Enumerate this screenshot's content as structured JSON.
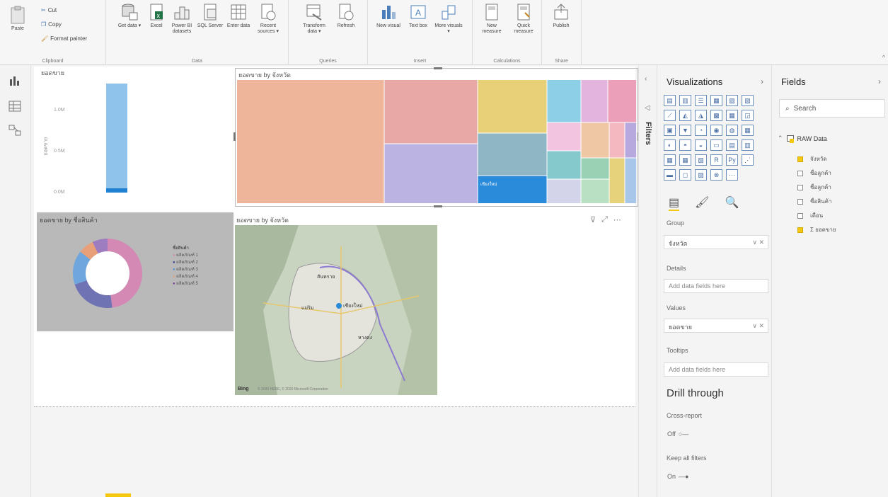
{
  "ribbon": {
    "clipboard": {
      "paste": "Paste",
      "cut": "Cut",
      "copy": "Copy",
      "format_painter": "Format painter",
      "label": "Clipboard"
    },
    "data": {
      "get_data": "Get data ▾",
      "excel": "Excel",
      "powerbi": "Power BI datasets",
      "sql": "SQL Server",
      "enter": "Enter data",
      "recent": "Recent sources ▾",
      "label": "Data"
    },
    "queries": {
      "transform": "Transform data ▾",
      "refresh": "Refresh",
      "label": "Queries"
    },
    "insert": {
      "new_visual": "New visual",
      "text_box": "Text box",
      "more_visuals": "More visuals ▾",
      "label": "Insert"
    },
    "calculations": {
      "new_measure": "New measure",
      "quick_measure": "Quick measure",
      "label": "Calculations"
    },
    "share": {
      "publish": "Publish",
      "label": "Share"
    }
  },
  "visuals": {
    "bar": {
      "title": "ยอดขาย",
      "yaxis": "ยอดขาย",
      "ticks": [
        "1.0M",
        "0.5M",
        "0.0M"
      ]
    },
    "treemap": {
      "title": "ยอดขาย by จังหวัด",
      "selected_label": "เชียงใหม่"
    },
    "donut": {
      "title": "ยอดขาย by ชื่อสินค้า",
      "legend_title": "ชื่อสินค้า",
      "legend": [
        "ผลิตภัณฑ์ 1",
        "ผลิตภัณฑ์ 2",
        "ผลิตภัณฑ์ 3",
        "ผลิตภัณฑ์ 4",
        "ผลิตภัณฑ์ 5"
      ]
    },
    "map": {
      "title": "ยอดขาย by จังหวัด",
      "labels": [
        "เชียงใหม่",
        "สันทราย",
        "หางดง",
        "แม่ริม"
      ],
      "attribution": "Bing",
      "copyright": "© 2020 HERE, © 2020 Microsoft Corporation"
    }
  },
  "filters": {
    "label": "Filters"
  },
  "viz_pane": {
    "title": "Visualizations",
    "icons": [
      "▤",
      "▥",
      "☰",
      "▦",
      "▧",
      "▨",
      "⟋",
      "◭",
      "◮",
      "▩",
      "▦",
      "◲",
      "▣",
      "▼",
      "◔",
      "◉",
      "◍",
      "▦",
      "◐",
      "◓",
      "◒",
      "▭",
      "▤",
      "▥",
      "▦",
      "▦",
      "▧",
      "R",
      "Py",
      "⋰",
      "▬",
      "◻",
      "▨",
      "⊗",
      "⋯"
    ],
    "tabs": [
      "fields-icon",
      "format-icon",
      "analytics-icon"
    ],
    "group_label": "Group",
    "group_value": "จังหวัด",
    "details_label": "Details",
    "details_placeholder": "Add data fields here",
    "values_label": "Values",
    "values_value": "ยอดขาย",
    "tooltips_label": "Tooltips",
    "tooltips_placeholder": "Add data fields here",
    "drill_title": "Drill through",
    "cross_report": "Cross-report",
    "cross_state": "Off",
    "keep_filters": "Keep all filters",
    "keep_state": "On"
  },
  "fields_pane": {
    "title": "Fields",
    "search_placeholder": "Search",
    "table": "RAW Data",
    "fields": [
      {
        "name": "จังหวัด",
        "checked": true
      },
      {
        "name": "ชื่อลูกค้า",
        "checked": false
      },
      {
        "name": "ชื่อลูกค้า",
        "checked": false
      },
      {
        "name": "ชื่อสินค้า",
        "checked": false
      },
      {
        "name": "เดือน",
        "checked": false
      },
      {
        "name": "Σ ยอดขาย",
        "checked": true
      }
    ]
  }
}
